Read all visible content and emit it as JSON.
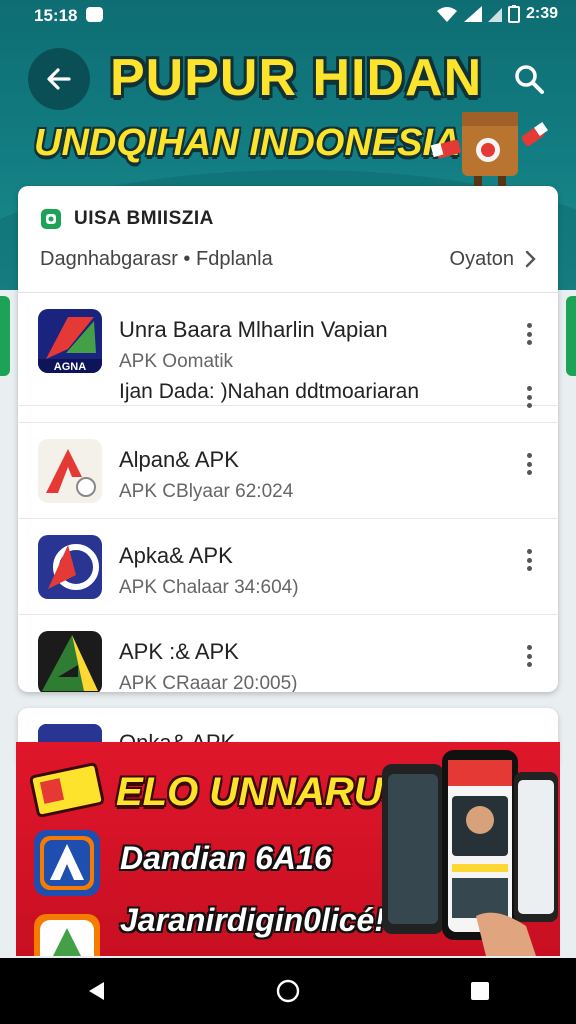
{
  "status_bar": {
    "time": "15:18",
    "battery_time": "2:39"
  },
  "header": {
    "title_line1": "PUPUR HIDAN",
    "title_line2": "UNDQIHAN INDONESIA"
  },
  "card": {
    "title": "UISA BMIISZIA",
    "subtitle": "Dagnhabgarasr • Fdplanla",
    "action_label": "Oyaton"
  },
  "apps": [
    {
      "name": "Unra Baara Mlharlin Vapian",
      "meta": "APK Oomatik",
      "extra": "Ijan Dada: )Nahan ddtmoariaran",
      "icon": "agna-app-icon",
      "icon_label": "AGNA"
    },
    {
      "name": "Alpan& APK",
      "meta": "APK CBlyaar 62:024",
      "icon": "red-a-app-icon"
    },
    {
      "name": "Apka& APK",
      "meta": "APK Chalaar 34:604)",
      "icon": "blue-d-app-icon"
    },
    {
      "name": "APK :& APK",
      "meta": "APK CRaaar 20:005)",
      "icon": "green-a-app-icon"
    }
  ],
  "peek_app": {
    "name": "Onka& APK"
  },
  "promo": {
    "title": "ELO UNNARUS",
    "line1": "Dandian 6A16",
    "line2": "Jaranirdigin0licé!"
  },
  "colors": {
    "header_teal": "#127e83",
    "title_yellow": "#fde32b",
    "promo_red": "#e0162b",
    "accent_green": "#1ca358"
  }
}
